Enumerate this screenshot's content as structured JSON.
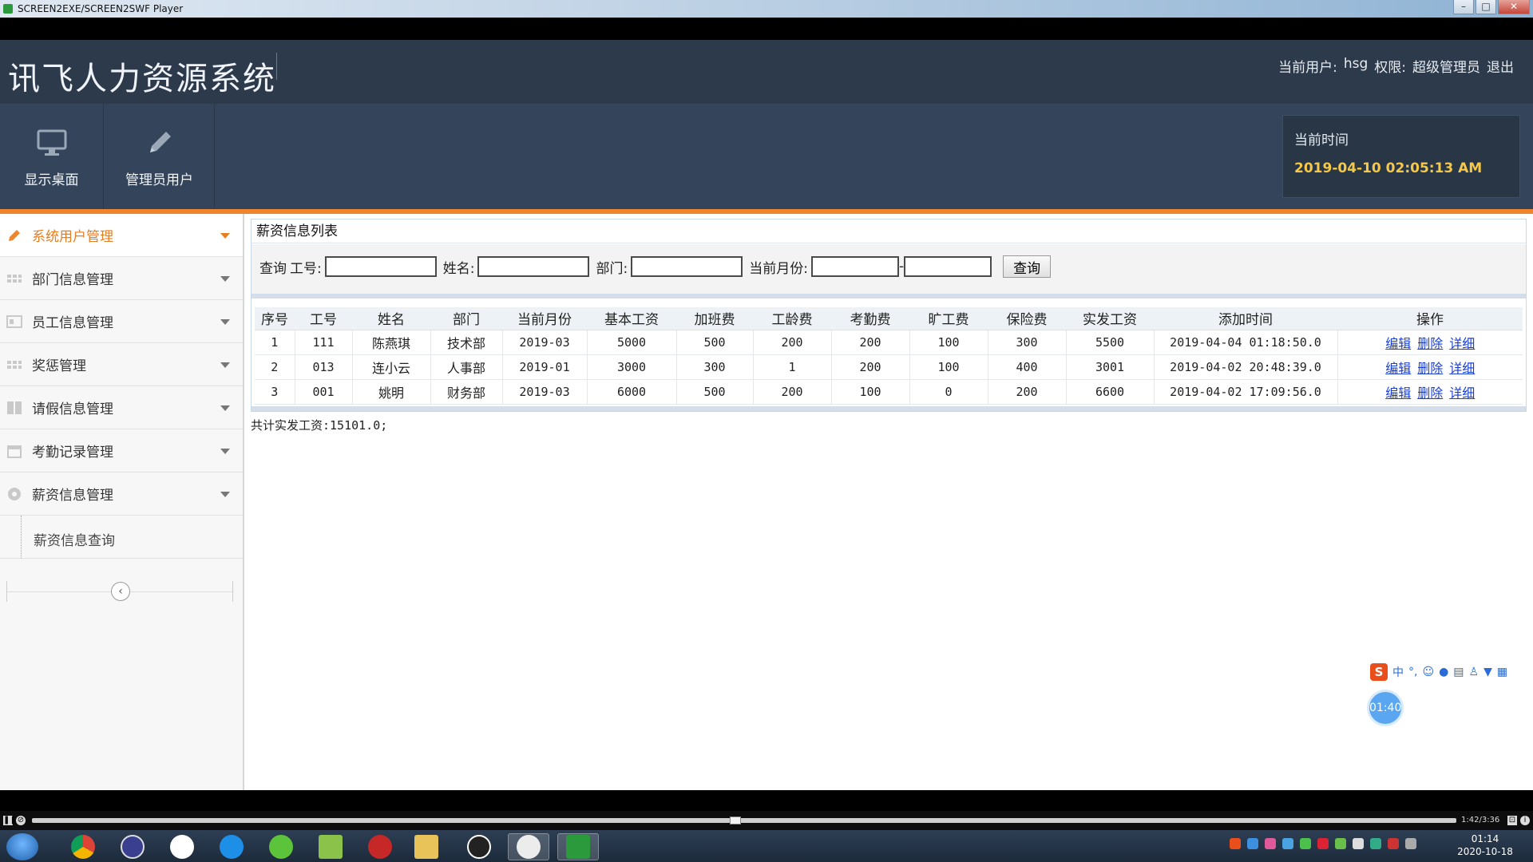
{
  "player": {
    "title": "SCREEN2EXE/SCREEN2SWF Player",
    "controls": {
      "minimize": "–",
      "maximize": "□",
      "close": "✕"
    },
    "time": "1:42/3:36",
    "progress": 0.49
  },
  "header": {
    "system_title": "讯飞人力资源系统",
    "current_user_label": "当前用户:",
    "current_user": "hsg",
    "permission_label": "权限:",
    "permission": "超级管理员",
    "logout": "退出"
  },
  "toolbar": {
    "buttons": [
      {
        "label": "显示桌面",
        "icon": "monitor-icon"
      },
      {
        "label": "管理员用户",
        "icon": "pencil-icon"
      }
    ],
    "time_label": "当前时间",
    "time_value": "2019-04-10 02:05:13 AM"
  },
  "sidebar": {
    "items": [
      {
        "label": "系统用户管理",
        "icon": "pencil-icon"
      },
      {
        "label": "部门信息管理",
        "icon": "grid-icon"
      },
      {
        "label": "员工信息管理",
        "icon": "card-icon"
      },
      {
        "label": "奖惩管理",
        "icon": "grid-icon"
      },
      {
        "label": "请假信息管理",
        "icon": "columns-icon"
      },
      {
        "label": "考勤记录管理",
        "icon": "calendar-icon"
      },
      {
        "label": "薪资信息管理",
        "icon": "gear-icon"
      }
    ],
    "sub_items": [
      {
        "label": "薪资信息查询"
      }
    ],
    "collapse": "‹"
  },
  "panel": {
    "title": "薪资信息列表",
    "search": {
      "query_label": "查询",
      "emp_no_label": "工号:",
      "name_label": "姓名:",
      "dept_label": "部门:",
      "month_label": "当前月份:",
      "range_sep": "-",
      "button": "查询"
    },
    "columns": [
      "序号",
      "工号",
      "姓名",
      "部门",
      "当前月份",
      "基本工资",
      "加班费",
      "工龄费",
      "考勤费",
      "旷工费",
      "保险费",
      "实发工资",
      "添加时间",
      "操作"
    ],
    "rows": [
      {
        "seq": "1",
        "emp_no": "111",
        "name": "陈燕琪",
        "dept": "技术部",
        "month": "2019-03",
        "base": "5000",
        "overtime": "500",
        "seniority": "200",
        "attendance": "200",
        "absence": "100",
        "insurance": "300",
        "net": "5500",
        "added": "2019-04-04 01:18:50.0"
      },
      {
        "seq": "2",
        "emp_no": "013",
        "name": "连小云",
        "dept": "人事部",
        "month": "2019-01",
        "base": "3000",
        "overtime": "300",
        "seniority": "1",
        "attendance": "200",
        "absence": "100",
        "insurance": "400",
        "net": "3001",
        "added": "2019-04-02 20:48:39.0"
      },
      {
        "seq": "3",
        "emp_no": "001",
        "name": "姚明",
        "dept": "财务部",
        "month": "2019-03",
        "base": "6000",
        "overtime": "500",
        "seniority": "200",
        "attendance": "100",
        "absence": "0",
        "insurance": "200",
        "net": "6600",
        "added": "2019-04-02 17:09:56.0"
      }
    ],
    "ops": {
      "edit": "编辑",
      "delete": "删除",
      "detail": "详细"
    },
    "total": "共计实发工资:15101.0;"
  },
  "overlays": {
    "ime_label": "中",
    "ime_punct": "°,",
    "timer": "01:40"
  },
  "taskbar": {
    "clock_time": "01:14",
    "clock_date": "2020-10-18"
  },
  "colors": {
    "header_bg": "#2c3a4c",
    "toolbar_bg": "#34445a",
    "accent": "#f0862b",
    "time_value": "#f5c84a",
    "link": "#1a3fd6"
  }
}
